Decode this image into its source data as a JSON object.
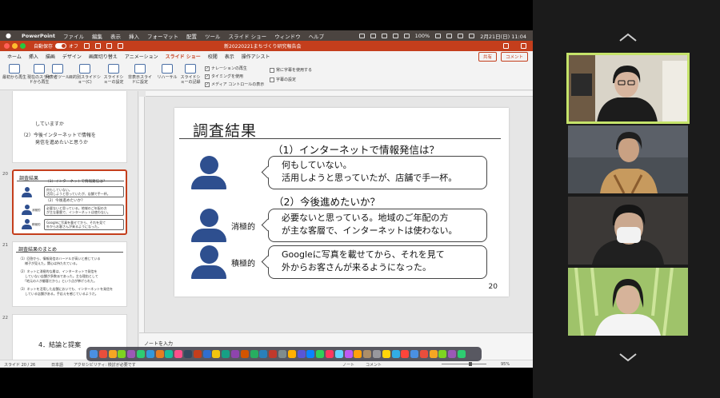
{
  "menubar": {
    "app": "PowerPoint",
    "items": [
      "ファイル",
      "編集",
      "表示",
      "挿入",
      "フォーマット",
      "配置",
      "ツール",
      "スライド ショー",
      "ウィンドウ",
      "ヘルプ"
    ],
    "battery": "100%",
    "datetime": "2月21日(日) 11:04"
  },
  "titlebar": {
    "autosave_label": "自動保存",
    "autosave_state": "オフ",
    "document_title": "新20220221まちづくり研究報告会"
  },
  "ribbon_tabs": [
    "ホーム",
    "挿入",
    "描画",
    "デザイン",
    "画面切り替え",
    "アニメーション",
    "スライド ショー",
    "校閲",
    "表示",
    "操作アシスト"
  ],
  "active_tab": "スライド ショー",
  "share_label": "共有",
  "comment_label": "コメント",
  "ribbon": {
    "buttons": [
      "最初から再生",
      "現在のスライドから再生",
      "発表者ツール",
      "目的別スライドショー(C)",
      "スライドショーの設定",
      "非表示スライドに設定",
      "リハーサル",
      "スライドショーの記録"
    ],
    "checks": [
      {
        "label": "ナレーションの再生",
        "checked": true
      },
      {
        "label": "タイミングを使用",
        "checked": true
      },
      {
        "label": "メディア コントロールの表示",
        "checked": true
      },
      {
        "label": "常に字幕を使用する",
        "checked": false
      },
      {
        "label": "字幕の設定",
        "checked": false
      }
    ]
  },
  "thumbnails": {
    "prev_slide_text": [
      "していますか",
      "（2）今後インターネットで情報を",
      "発信を進めたいと思うか"
    ],
    "slide20": {
      "number": "20",
      "title": "調査結果",
      "q1": "（1）インターネットで情報発信は？",
      "a1": [
        "何もしていない。",
        "活用しようと思っていたが、店舗で手一杯。"
      ],
      "q2": "（2）今後進めたいか？",
      "a2": [
        "必要ないと思っている。地域のご年配の方",
        "が主な客層で、インターネットは使わない。"
      ],
      "a3": [
        "Googleに写真を載せてから、それを見て",
        "外からお客さんが来るようになった。"
      ],
      "label2": "消極的",
      "label3": "積極的"
    },
    "slide21": {
      "number": "21",
      "title": "調査結果のまとめ",
      "lines": [
        "（1）回答から、情報発信のハードルが高いと感じている",
        "　　様子が見えた。関心は持たれている。",
        "（2）ネットに消極的な層は、インターネットで発信を",
        "　　していない店舗が多数派であった。主な理由として",
        "　　「地元の人が顧客だから」という点が挙げられた。",
        "（3）ネットを活用した店舗においても、インターネットを発信を",
        "　　している店舗がある。手応えを感じているようだ。"
      ]
    },
    "slide22": {
      "number": "22",
      "text": "4．結論と提案"
    }
  },
  "slide": {
    "title": "調査結果",
    "q1": "（1）インターネットで情報発信は？",
    "answer1_line1": "何もしていない。",
    "answer1_line2": "活用しようと思っていたが、店舗で手一杯。",
    "q2": "（2）今後進めたいか？",
    "answer2_line1": "必要ないと思っている。地域のご年配の方",
    "answer2_line2": "が主な客層で、インターネットは使わない。",
    "answer3_line1": "Googleに写真を載せてから、それを見て",
    "answer3_line2": "外からお客さんが来るようになった。",
    "label_negative": "消極的",
    "label_positive": "積極的",
    "page": "20"
  },
  "notes_placeholder": "ノートを入力",
  "statusbar": {
    "slide_count": "スライド 20 / 26",
    "language": "日本語",
    "accessibility": "アクセシビリティ: 検討が必要です",
    "notes": "ノート",
    "comments": "コメント",
    "zoom": "95%"
  },
  "colors": {
    "accent": "#c43e1c",
    "figure_blue": "#2e4f8f",
    "speaker_outline": "#c5e36a"
  }
}
